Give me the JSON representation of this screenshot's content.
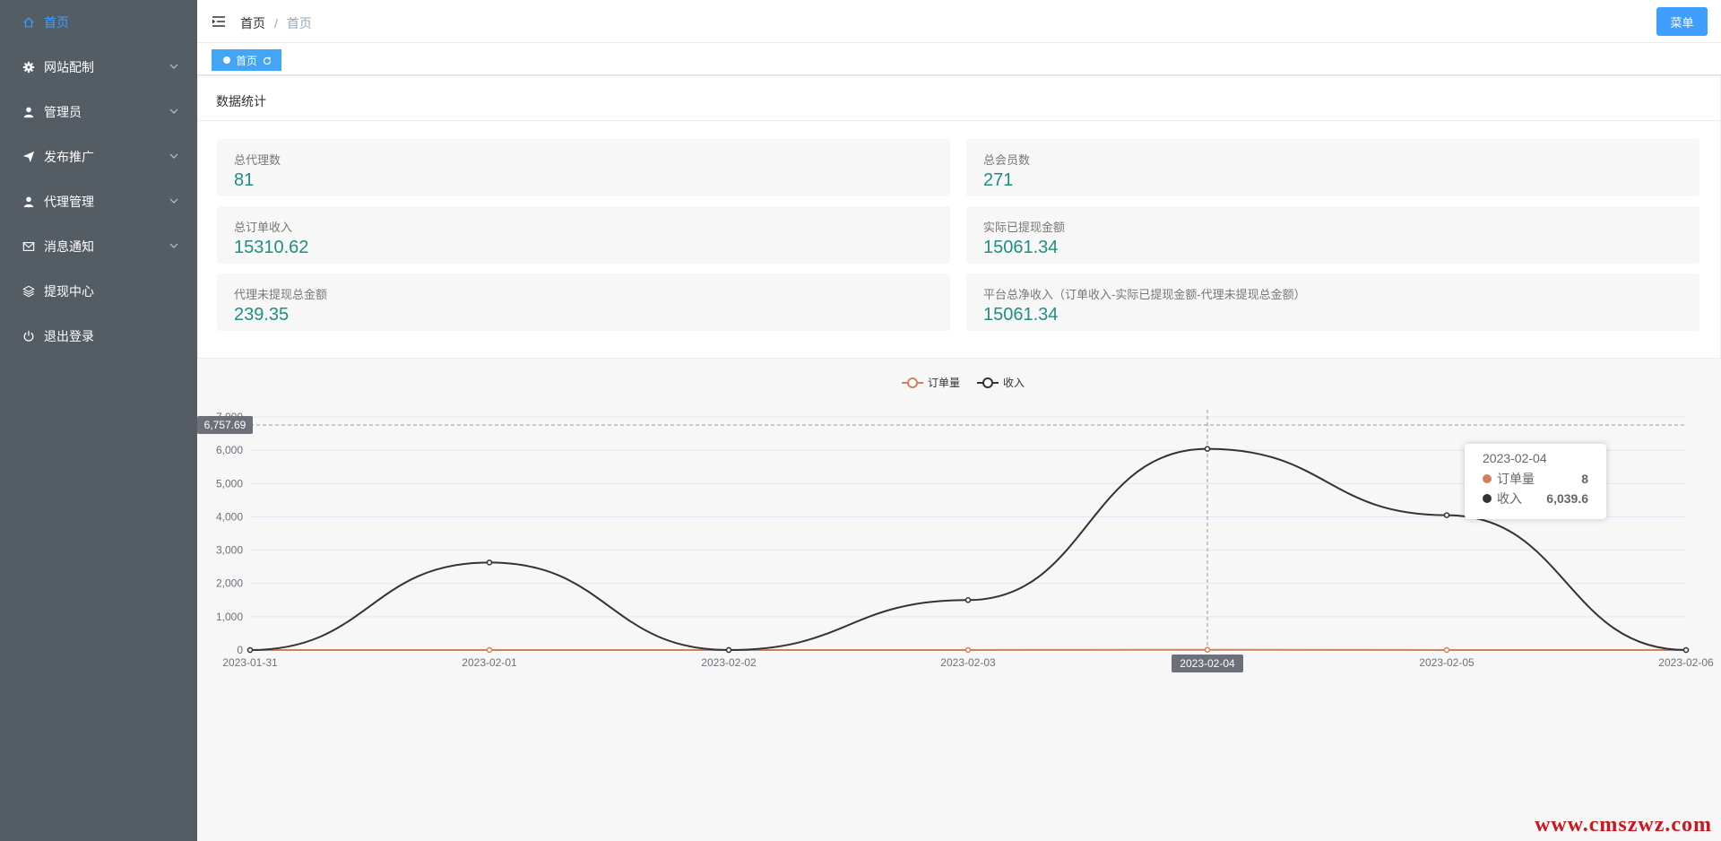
{
  "sidebar": {
    "items": [
      {
        "label": "首页",
        "icon": "home-icon",
        "active": true,
        "expandable": false
      },
      {
        "label": "网站配制",
        "icon": "gear-icon",
        "active": false,
        "expandable": true
      },
      {
        "label": "管理员",
        "icon": "user-icon",
        "active": false,
        "expandable": true
      },
      {
        "label": "发布推广",
        "icon": "send-icon",
        "active": false,
        "expandable": true
      },
      {
        "label": "代理管理",
        "icon": "user-icon",
        "active": false,
        "expandable": true
      },
      {
        "label": "消息通知",
        "icon": "mail-icon",
        "active": false,
        "expandable": true
      },
      {
        "label": "提现中心",
        "icon": "layers-icon",
        "active": false,
        "expandable": false
      },
      {
        "label": "退出登录",
        "icon": "power-icon",
        "active": false,
        "expandable": false
      }
    ]
  },
  "header": {
    "breadcrumb": [
      "首页",
      "首页"
    ],
    "menu_button": "菜单"
  },
  "tags": {
    "active_tag": "首页"
  },
  "card": {
    "title": "数据统计",
    "stats": [
      {
        "label": "总代理数",
        "value": "81"
      },
      {
        "label": "总会员数",
        "value": "271"
      },
      {
        "label": "总订单收入",
        "value": "15310.62"
      },
      {
        "label": "实际已提现金额",
        "value": "15061.34"
      },
      {
        "label": "代理未提现总金额",
        "value": "239.35"
      },
      {
        "label": "平台总净收入（订单收入-实际已提现金额-代理未提现总金额）",
        "value": "15061.34"
      }
    ]
  },
  "chart_data": {
    "type": "line",
    "categories": [
      "2023-01-31",
      "2023-02-01",
      "2023-02-02",
      "2023-02-03",
      "2023-02-04",
      "2023-02-05",
      "2023-02-06"
    ],
    "series": [
      {
        "name": "订单量",
        "color": "#d2805b",
        "values": [
          0,
          0,
          0,
          0,
          8,
          0,
          0
        ]
      },
      {
        "name": "收入",
        "color": "#333333",
        "values": [
          0,
          2630,
          0,
          1500,
          6039.6,
          4050,
          0
        ]
      }
    ],
    "y_ticks": [
      "0",
      "1,000",
      "2,000",
      "3,000",
      "4,000",
      "5,000",
      "6,000",
      "7,000"
    ],
    "ylim": [
      0,
      7000
    ],
    "legend_position": "top-center",
    "axis_pointer": {
      "y_label": "6,757.69",
      "y_value": 6757.69,
      "x_label": "2023-02-04"
    },
    "tooltip": {
      "date": "2023-02-04",
      "rows": [
        {
          "name": "订单量",
          "value": "8",
          "color": "#d2805b"
        },
        {
          "name": "收入",
          "value": "6,039.6",
          "color": "#333333"
        }
      ]
    }
  },
  "watermark": "www.cmszwz.com",
  "colors": {
    "sidebar_bg": "#545c64",
    "accent": "#409eff",
    "value_green": "#1e8f82"
  }
}
